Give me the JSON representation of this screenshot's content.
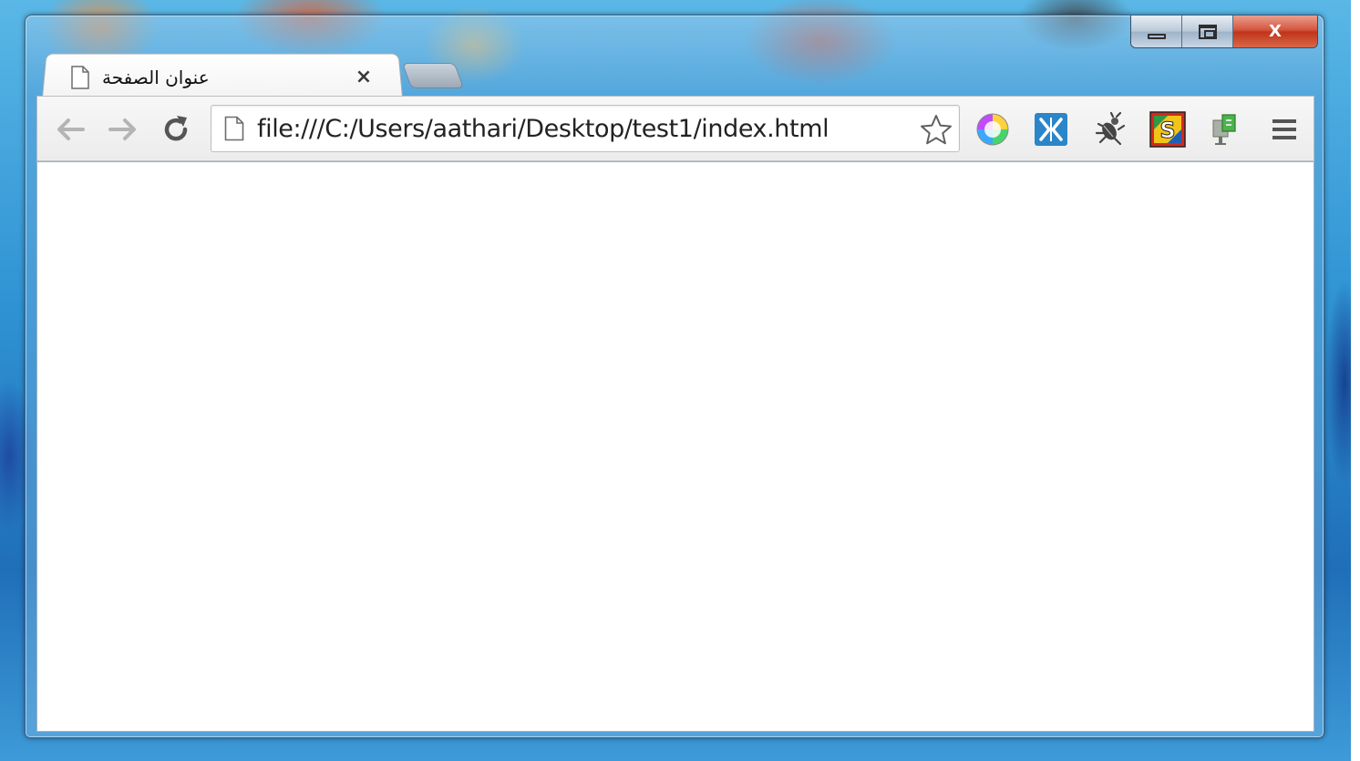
{
  "browser": {
    "tab": {
      "title": "عنوان الصفحة",
      "close_glyph": "×",
      "icon": "page-icon"
    },
    "new_tab": {
      "icon": "new-tab-icon"
    },
    "toolbar": {
      "back_icon": "back-arrow-icon",
      "forward_icon": "forward-arrow-icon",
      "reload_icon": "reload-icon",
      "url": "file:///C:/Users/aathari/Desktop/test1/index.html",
      "url_icon": "page-icon",
      "bookmark_icon": "star-icon",
      "extensions": [
        "color-wheel-icon",
        "split-x-icon",
        "bug-icon",
        "s-badge-icon",
        "green-extension-icon"
      ],
      "menu_icon": "menu-icon"
    },
    "window_controls": {
      "minimize_icon": "minimize-icon",
      "maximize_icon": "maximize-icon",
      "close_glyph": "X"
    }
  },
  "colors": {
    "close_red": "#c0341a",
    "extension_blue": "#2a86c9",
    "s_badge_red": "#d22a1e",
    "s_badge_yellow": "#f2c418"
  }
}
